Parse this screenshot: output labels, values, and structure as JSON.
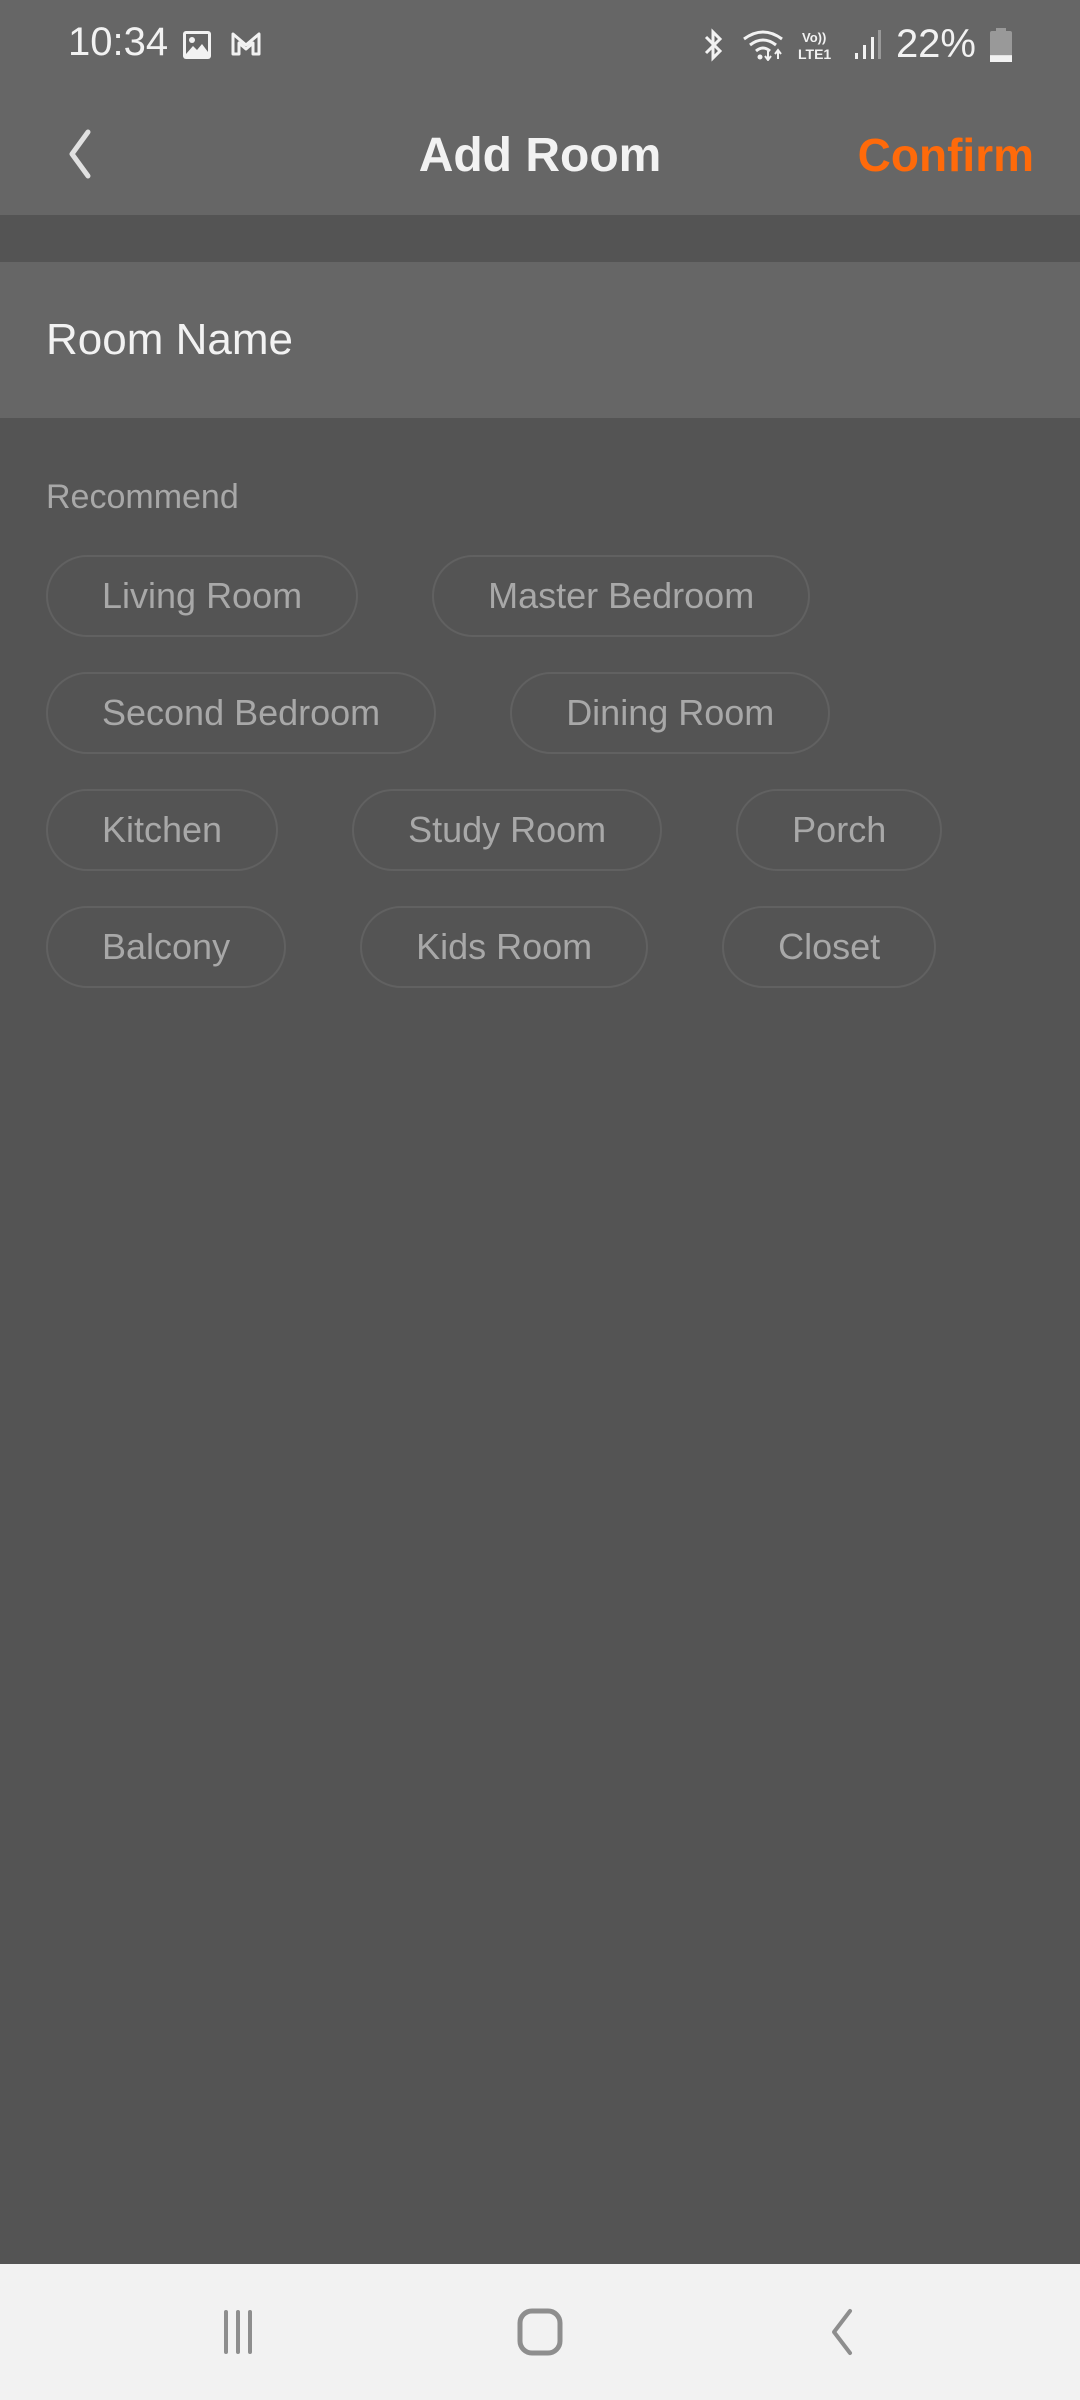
{
  "status_bar": {
    "time": "10:34",
    "left_icons": [
      "gallery-icon",
      "gmail-icon"
    ],
    "right_icons": [
      "bluetooth-icon",
      "wifi-icon",
      "volte-lte-icon",
      "signal-icon"
    ],
    "battery_percent": "22%",
    "battery_level": 0.22
  },
  "header": {
    "back_icon": "chevron-left-icon",
    "title": "Add Room",
    "confirm_label": "Confirm"
  },
  "form": {
    "room_name_placeholder": "Room Name",
    "room_name_value": ""
  },
  "recommend": {
    "label": "Recommend",
    "rows": [
      [
        "Living Room",
        "Master Bedroom"
      ],
      [
        "Second Bedroom",
        "Dining Room"
      ],
      [
        "Kitchen",
        "Study Room",
        "Porch"
      ],
      [
        "Balcony",
        "Kids Room",
        "Closet"
      ]
    ]
  },
  "nav_bar": {
    "buttons": [
      "recents-icon",
      "home-icon",
      "back-icon"
    ]
  },
  "colors": {
    "accent": "#ff6a0a",
    "header_bg": "#666666",
    "page_bg": "#545454",
    "chip_text": "#a8a8a8",
    "nav_bg": "#f2f2f2"
  }
}
